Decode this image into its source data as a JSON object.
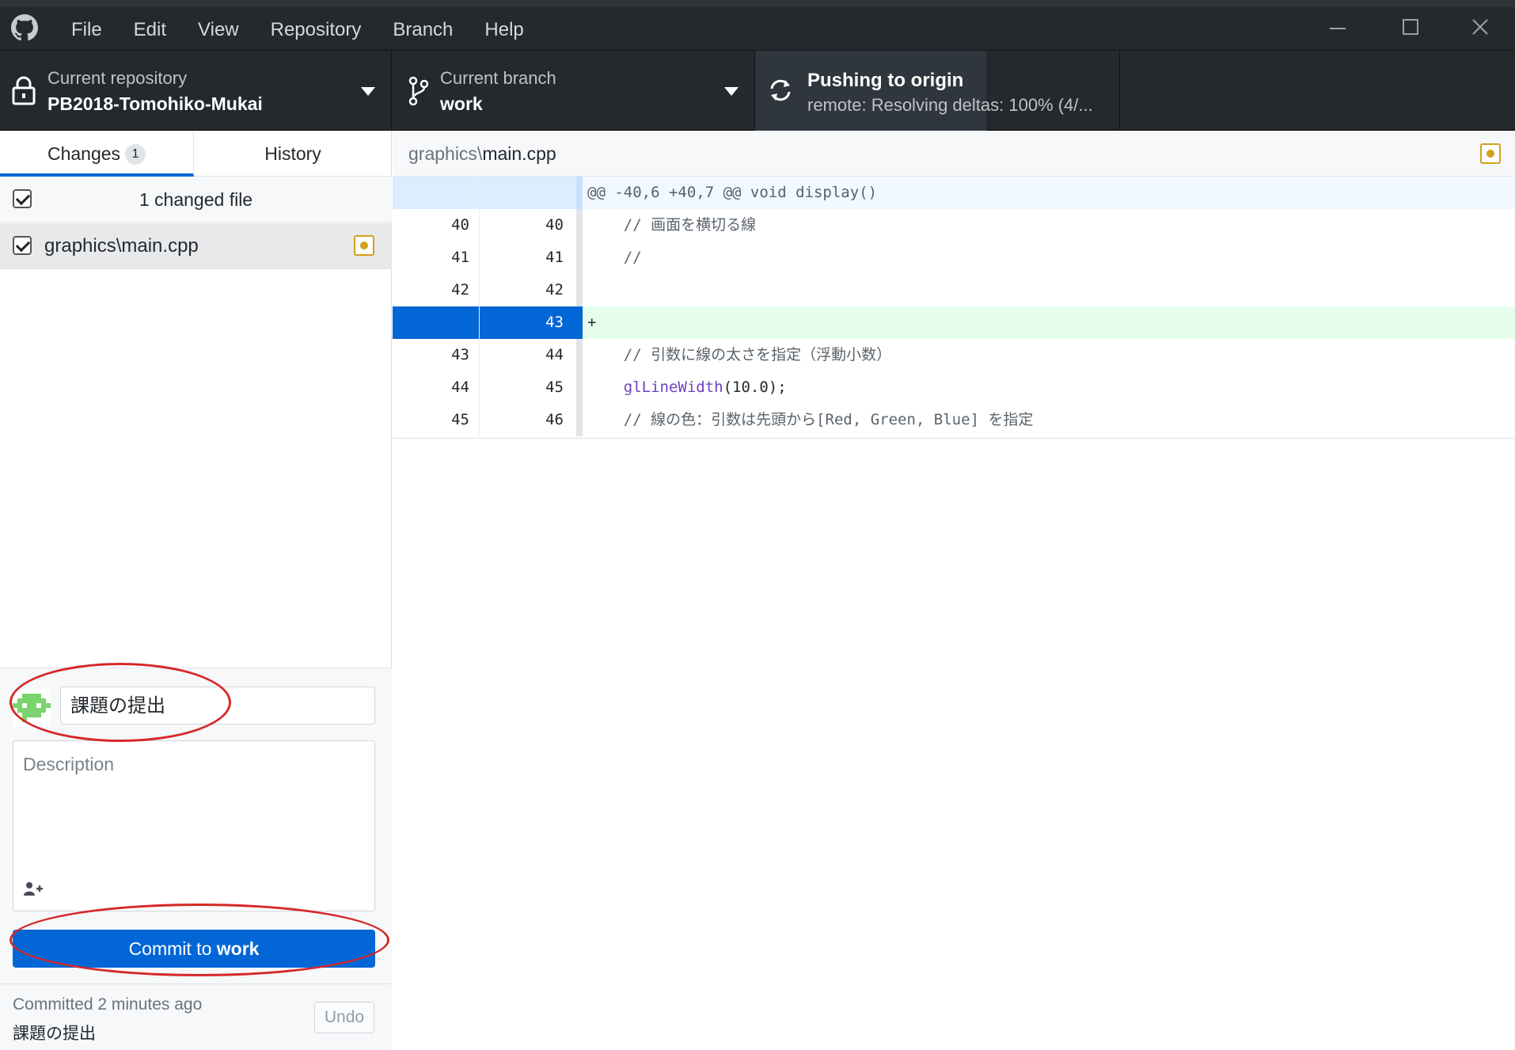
{
  "menu": [
    "File",
    "Edit",
    "View",
    "Repository",
    "Branch",
    "Help"
  ],
  "toolbar": {
    "repo_title": "Current repository",
    "repo_value": "PB2018-Tomohiko-Mukai",
    "branch_title": "Current branch",
    "branch_value": "work",
    "push_title": "Pushing to origin",
    "push_sub": "remote: Resolving deltas: 100% (4/..."
  },
  "tabs": {
    "changes": "Changes",
    "changes_count": "1",
    "history": "History"
  },
  "changes": {
    "header": "1 changed file",
    "files": [
      {
        "name": "graphics\\main.cpp"
      }
    ]
  },
  "commit": {
    "summary_value": "課題の提出",
    "description_placeholder": "Description",
    "button_prefix": "Commit to ",
    "button_branch": "work"
  },
  "last_commit": {
    "when": "Committed 2 minutes ago",
    "message": "課題の提出",
    "undo": "Undo"
  },
  "diff": {
    "path_dir": "graphics\\",
    "path_file": "main.cpp",
    "rows": [
      {
        "old": "",
        "new": "",
        "code": "@@ -40,6 +40,7 @@ void display()"
      },
      {
        "old": "40",
        "new": "40",
        "code": "    // 画面を横切る線"
      },
      {
        "old": "41",
        "new": "41",
        "code": "    //"
      },
      {
        "old": "42",
        "new": "42",
        "code": ""
      },
      {
        "old": "",
        "new": "43",
        "code": "+"
      },
      {
        "old": "43",
        "new": "44",
        "code": "    // 引数に線の太さを指定（浮動小数）"
      },
      {
        "old": "44",
        "new": "45",
        "code_fn": "glLineWidth",
        "code_rest": "(10.0);"
      },
      {
        "old": "45",
        "new": "46",
        "code": "    // 線の色：引数は先頭から[Red, Green, Blue] を指定"
      }
    ]
  },
  "colors": {
    "accent": "#0366d6",
    "toolbar_bg": "#24292e",
    "modified": "#d4a01c",
    "added_line_bg": "#e6ffed",
    "annotation": "#d62828"
  },
  "icons": [
    "github-logo-icon",
    "lock-icon",
    "branch-icon",
    "sync-icon",
    "caret-down-icon",
    "modified-file-icon",
    "add-coauthor-icon",
    "minimize-icon",
    "maximize-icon",
    "close-icon"
  ]
}
